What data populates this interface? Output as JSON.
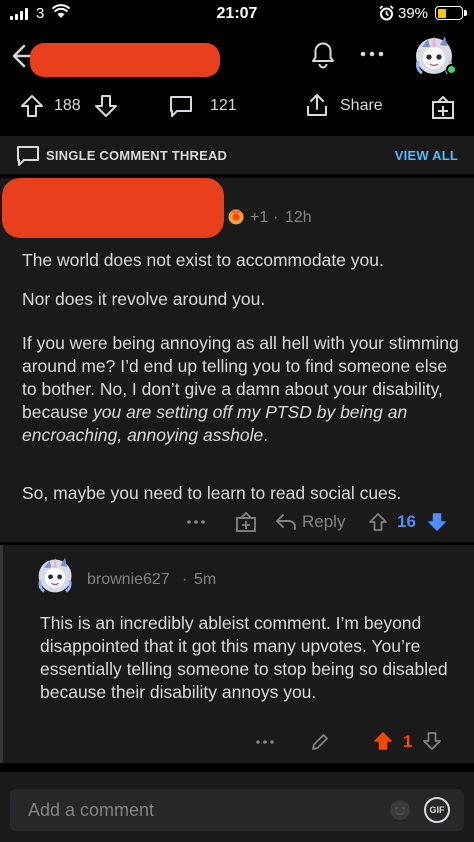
{
  "status_bar": {
    "carrier": "3",
    "time": "21:07",
    "battery": "39%"
  },
  "post": {
    "upvotes": "188",
    "comments": "121",
    "share_label": "Share"
  },
  "thread": {
    "label": "SINGLE COMMENT THREAD",
    "view_all": "VIEW ALL"
  },
  "parent_comment": {
    "award_count": "+1",
    "sep": "·",
    "time": "12h",
    "paragraphs": [
      "The world does not exist to accommodate you.",
      "Nor does it revolve around you.",
      "If you were being annoying as all hell with your stimming around me? I’d end up telling you to find someone else to bother. No, I don’t give a damn about your disability, because ",
      "you are setting off my PTSD by being an encroaching, annoying asshole",
      ".",
      "So, maybe you need to learn to read social cues."
    ],
    "reply_label": "Reply",
    "score": "16"
  },
  "reply_comment": {
    "username": "brownie627",
    "sep": "·",
    "time": "5m",
    "body": "This is an incredibly ableist comment. I’m beyond disappointed that it got this many upvotes. You’re essentially telling someone to stop being so disabled because their disability annoys you.",
    "score": "1"
  },
  "composer": {
    "placeholder": "Add a comment",
    "gif_label": "GIF"
  },
  "colors": {
    "background": "#000000",
    "card": "#1a1a1b",
    "redaction": "#e8401c",
    "link": "#4fbcff",
    "upvote_active": "#ff4500",
    "downvote_active": "#4f8cff"
  }
}
